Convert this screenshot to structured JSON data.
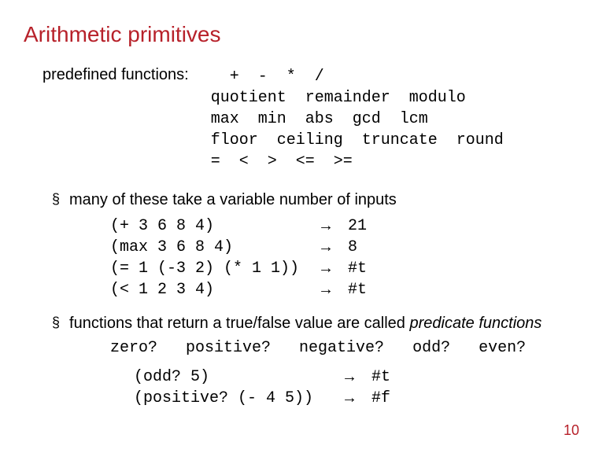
{
  "title": "Arithmetic primitives",
  "predefined_label": "predefined functions:",
  "functions_block": "  +  -  *  /\nquotient  remainder  modulo\nmax  min  abs  gcd  lcm\nfloor  ceiling  truncate  round\n=  <  >  <=  >=",
  "bullet1": "many of these take a variable number of inputs",
  "example1_left": "(+ 3 6 8 4)           \n(max 3 6 8 4)         \n(= 1 (-3 2) (* 1 1))  \n(< 1 2 3 4)           ",
  "example1_arrows": "→\n→\n→\n→",
  "example1_right": "21\n8\n#t\n#t",
  "bullet2_a": "functions that return a true/false value are called ",
  "bullet2_b": "predicate functions",
  "predicates_line": "zero?   positive?   negative?   odd?   even?",
  "example2_left": "(odd? 5)              \n(positive? (- 4 5))   ",
  "example2_arrows": "→\n→",
  "example2_right": "#t\n#f",
  "page_number": "10"
}
